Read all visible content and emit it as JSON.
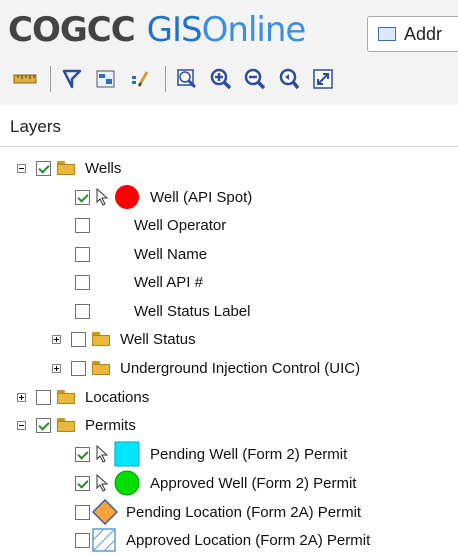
{
  "header": {
    "brand_cogcc": "COGCC",
    "brand_gis": "GIS",
    "brand_online": "Online",
    "address_button_label": "Addr"
  },
  "toolbar": {
    "tools": [
      "measure-icon",
      "identify-icon",
      "select-icon",
      "edit-icon",
      "zoom-to-box-icon",
      "zoom-in-icon",
      "zoom-out-icon",
      "zoom-previous-icon",
      "full-extent-icon"
    ]
  },
  "panel": {
    "title": "Layers"
  },
  "layers": {
    "wells": {
      "label": "Wells",
      "checked": true,
      "expanded": true
    },
    "well_api_spot": {
      "label": "Well (API Spot)",
      "checked": true,
      "symbol_color": "#ff0000"
    },
    "well_operator": {
      "label": "Well Operator",
      "checked": false
    },
    "well_name": {
      "label": "Well Name",
      "checked": false
    },
    "well_api_num": {
      "label": "Well API #",
      "checked": false
    },
    "well_status_label": {
      "label": "Well Status Label",
      "checked": false
    },
    "well_status": {
      "label": "Well Status",
      "checked": false,
      "expanded": false
    },
    "uic": {
      "label": "Underground Injection Control (UIC)",
      "checked": false,
      "expanded": false
    },
    "locations": {
      "label": "Locations",
      "checked": false,
      "expanded": false
    },
    "permits": {
      "label": "Permits",
      "checked": true,
      "expanded": true
    },
    "pending_well": {
      "label": "Pending Well (Form 2) Permit",
      "checked": true,
      "symbol_color": "#00e5ff"
    },
    "approved_well": {
      "label": "Approved Well (Form 2) Permit",
      "checked": true,
      "symbol_color": "#00dd00"
    },
    "pending_location": {
      "label": "Pending Location (Form 2A) Permit",
      "checked": false,
      "symbol_color": "#f7a23b"
    },
    "approved_location": {
      "label": "Approved Location (Form 2A) Permit",
      "checked": false,
      "symbol_color": "#5b9bd5"
    }
  }
}
